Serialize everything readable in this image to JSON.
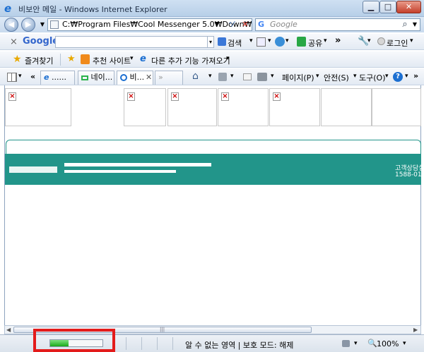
{
  "window": {
    "title": "비보안 메일 - Windows Internet Explorer",
    "min": "▁",
    "max": "□",
    "close": "✕"
  },
  "nav": {
    "back": "◀",
    "forward": "▶",
    "address": "C:₩Program Files₩Cool Messenger 5.0₩Down₩정",
    "refresh": "⁺⁄",
    "stop": "✕",
    "search_placeholder": "Google",
    "search_glyph": "⌕"
  },
  "google_bar": {
    "close": "×",
    "logo": "Google",
    "search_label": "검색",
    "share_label": "공유",
    "more": "»",
    "login_label": "로그인",
    "arrow": "▾"
  },
  "favorites_bar": {
    "favorites_label": "즐겨찾기",
    "suggested_sites": "추천 사이트",
    "get_more_addons": "다른 추가 기능 가져오기"
  },
  "command_bar": {
    "tabs": [
      {
        "label": "......"
      },
      {
        "label": "네이..."
      },
      {
        "label": "비..."
      }
    ],
    "tab_more": "»",
    "page_label": "페이지(P)",
    "safety_label": "안전(S)",
    "tools_label": "도구(O)",
    "help": "?",
    "quick_tabs": "«"
  },
  "content": {
    "teal_right_line1": "고객상담실",
    "teal_right_line2": "1588-01"
  },
  "statusbar": {
    "progress_fraction": 0.35,
    "zone": "알 수 없는 영역 | 보호 모드: 해제",
    "zoom": "100%"
  },
  "colors": {
    "accent": "#22958a",
    "highlight": "#e31b1b"
  }
}
